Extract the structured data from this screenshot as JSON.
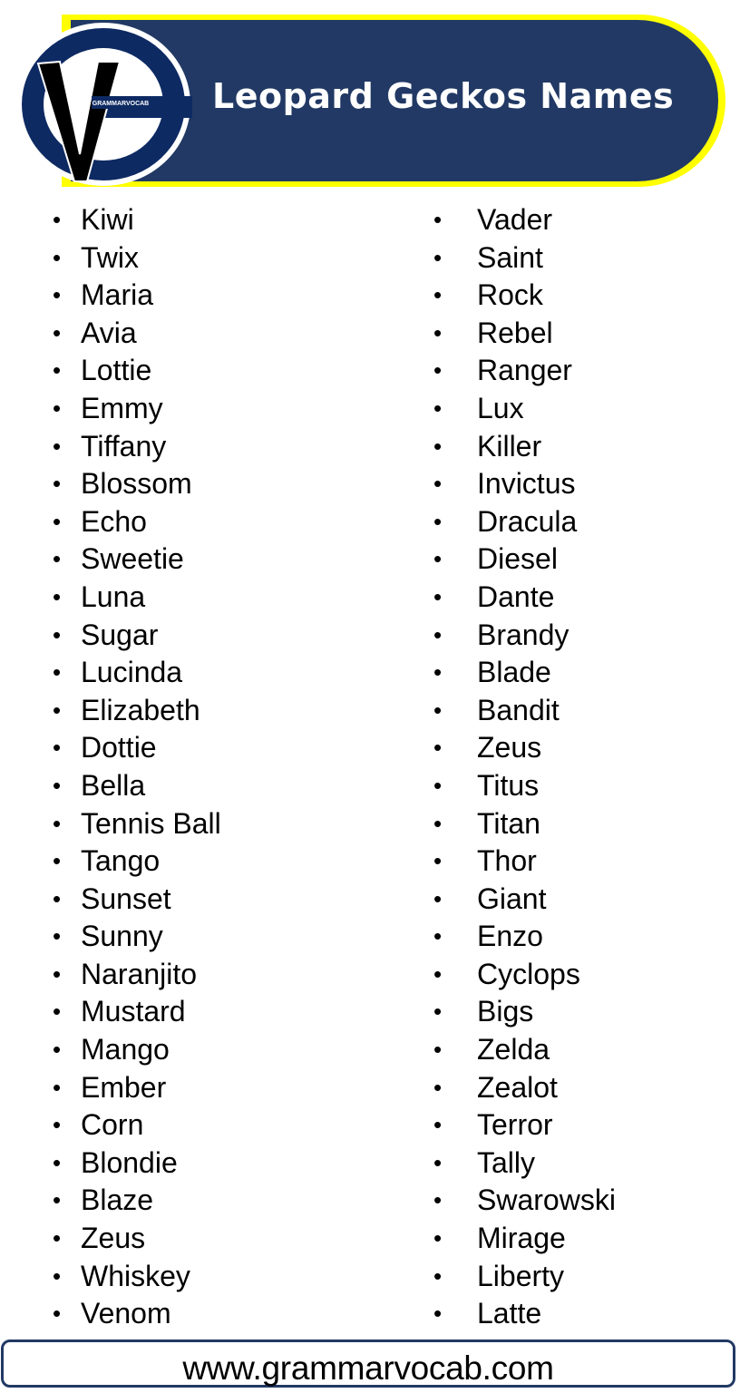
{
  "header": {
    "title": "Leopard Geckos Names",
    "logo_text": "GRAMMARVOCAB",
    "colors": {
      "banner": "#213964",
      "border": "#ffff00",
      "logo_blue": "#0e2a63"
    }
  },
  "bullet_symbol": "•",
  "names_left": [
    "Kiwi",
    "Twix",
    "Maria",
    "Avia",
    "Lottie",
    "Emmy",
    "Tiffany",
    "Blossom",
    "Echo",
    "Sweetie",
    "Luna",
    "Sugar",
    "Lucinda",
    "Elizabeth",
    "Dottie",
    "Bella",
    "Tennis Ball",
    "Tango",
    "Sunset",
    "Sunny",
    "Naranjito",
    "Mustard",
    "Mango",
    "Ember",
    "Corn",
    "Blondie",
    "Blaze",
    "Zeus",
    "Whiskey",
    "Venom"
  ],
  "names_right": [
    "Vader",
    "Saint",
    "Rock",
    "Rebel",
    "Ranger",
    "Lux",
    "Killer",
    "Invictus",
    "Dracula",
    "Diesel",
    "Dante",
    "Brandy",
    "Blade",
    "Bandit",
    "Zeus",
    "Titus",
    "Titan",
    "Thor",
    "Giant",
    "Enzo",
    "Cyclops",
    "Bigs",
    "Zelda",
    "Zealot",
    "Terror",
    "Tally",
    "Swarowski",
    "Mirage",
    "Liberty",
    "Latte"
  ],
  "footer": {
    "url": "www.grammarvocab.com"
  }
}
